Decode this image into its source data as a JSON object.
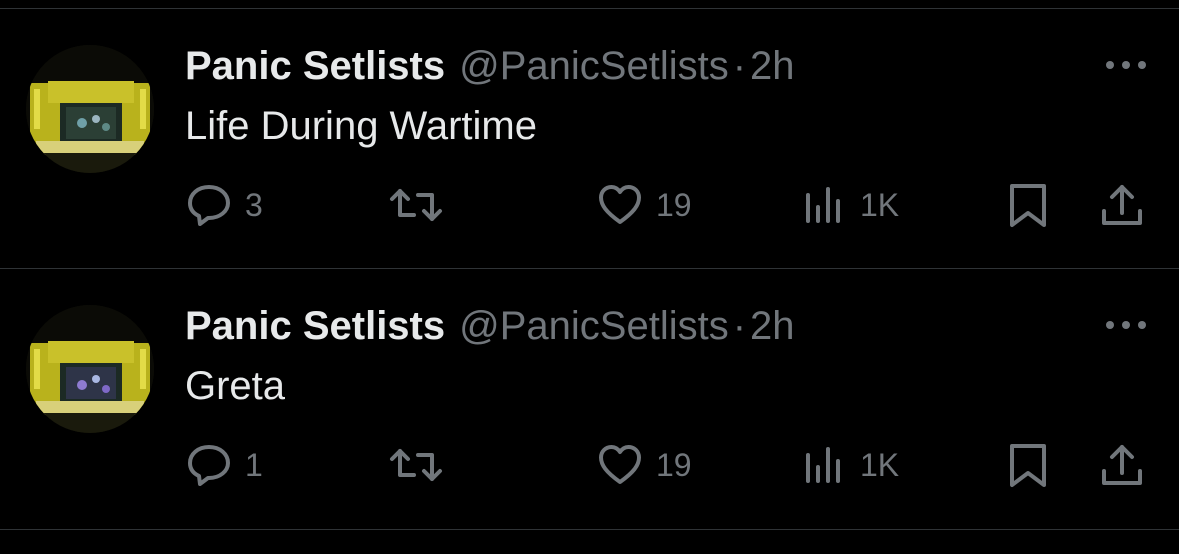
{
  "colors": {
    "background": "#000000",
    "primary_text": "#e7e9ea",
    "secondary_text": "#71767b",
    "divider": "#2f3336"
  },
  "tweets": [
    {
      "display_name": "Panic Setlists",
      "handle": "@PanicSetlists",
      "separator": "·",
      "time": "2h",
      "text": "Life During Wartime",
      "replies": "3",
      "likes": "19",
      "views": "1K"
    },
    {
      "display_name": "Panic Setlists",
      "handle": "@PanicSetlists",
      "separator": "·",
      "time": "2h",
      "text": "Greta",
      "replies": "1",
      "likes": "19",
      "views": "1K"
    }
  ],
  "icons": {
    "more": "more-horizontal-icon",
    "reply": "reply-bubble-icon",
    "retweet": "retweet-arrows-icon",
    "like": "heart-icon",
    "views": "bar-chart-icon",
    "bookmark": "bookmark-icon",
    "share": "share-upload-icon"
  }
}
